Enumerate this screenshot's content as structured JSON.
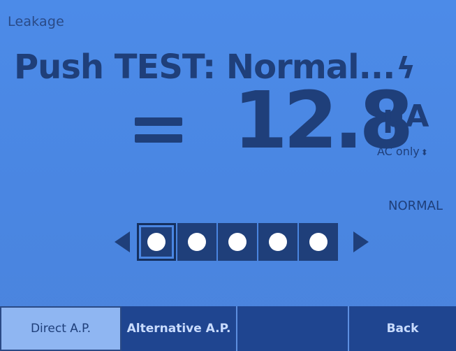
{
  "header": {
    "mode_title": "Leakage",
    "status_text": "Push TEST: Normal...",
    "status_icon": "lightning-bolt-icon"
  },
  "measurement": {
    "prefix": "=",
    "value": "12.8",
    "unit": "µA",
    "ac_mode": "AC only",
    "ac_mode_icon": "up-down-arrows-icon"
  },
  "polarity_label": "NORMAL",
  "selector": {
    "slots": 5,
    "selected_index": 0
  },
  "softkeys": {
    "key1": "Direct A.P.",
    "key2": "Alternative A.P.",
    "key3": "",
    "key4": "Back"
  },
  "colors": {
    "screen": "#4a86e2",
    "foreground": "#1f3f7a",
    "softkey_dark": "#1f4590"
  }
}
